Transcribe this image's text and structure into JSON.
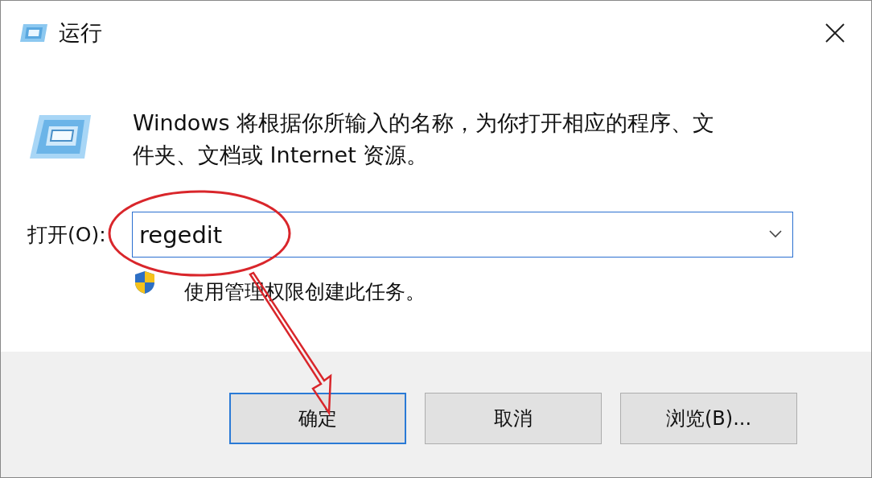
{
  "window": {
    "title": "运行"
  },
  "description": "Windows 将根据你所输入的名称，为你打开相应的程序、文件夹、文档或 Internet 资源。",
  "open_field": {
    "label": "打开(O):",
    "value": "regedit"
  },
  "admin_note": "使用管理权限创建此任务。",
  "buttons": [
    {
      "label": "确定",
      "default": true
    },
    {
      "label": "取消",
      "default": false
    },
    {
      "label": "浏览(B)...",
      "default": false
    }
  ]
}
